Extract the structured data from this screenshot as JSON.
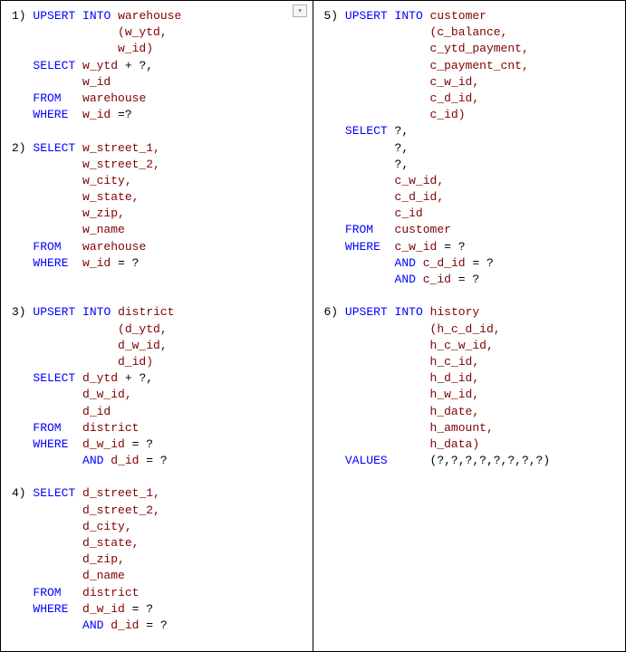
{
  "left": {
    "q1": {
      "num": "1)",
      "upsert": "UPSERT",
      "into": "INTO",
      "table": "warehouse",
      "col1": "(w_ytd,",
      "col2": "w_id)",
      "select": "SELECT",
      "sel1": "w_ytd",
      "plus": " + ?,",
      "sel2": "w_id",
      "from": "FROM",
      "from_t": "warehouse",
      "where": "WHERE",
      "cond": "w_id",
      "condop": " =?"
    },
    "q2": {
      "num": "2)",
      "select": "SELECT",
      "c1": "w_street_1,",
      "c2": "w_street_2,",
      "c3": "w_city,",
      "c4": "w_state,",
      "c5": "w_zip,",
      "c6": "w_name",
      "from": "FROM",
      "from_t": "warehouse",
      "where": "WHERE",
      "cond": "w_id",
      "condop": " = ?"
    },
    "q3": {
      "num": "3)",
      "upsert": "UPSERT",
      "into": "INTO",
      "table": "district",
      "col1": "(d_ytd,",
      "col2": "d_w_id,",
      "col3": "d_id)",
      "select": "SELECT",
      "sel1": "d_ytd",
      "plus": " + ?,",
      "sel2": "d_w_id,",
      "sel3": "d_id",
      "from": "FROM",
      "from_t": "district",
      "where": "WHERE",
      "cond1": "d_w_id",
      "op1": " = ?",
      "and": "AND",
      "cond2": "d_id",
      "op2": " = ?"
    },
    "q4": {
      "num": "4)",
      "select": "SELECT",
      "c1": "d_street_1,",
      "c2": "d_street_2,",
      "c3": "d_city,",
      "c4": "d_state,",
      "c5": "d_zip,",
      "c6": "d_name",
      "from": "FROM",
      "from_t": "district",
      "where": "WHERE",
      "cond1": "d_w_id",
      "op1": " = ?",
      "and": "AND",
      "cond2": "d_id",
      "op2": " = ?"
    }
  },
  "right": {
    "q5": {
      "num": "5)",
      "upsert": "UPSERT",
      "into": "INTO",
      "table": "customer",
      "col1": "(c_balance,",
      "col2": "c_ytd_payment,",
      "col3": "c_payment_cnt,",
      "col4": "c_w_id,",
      "col5": "c_d_id,",
      "col6": "c_id)",
      "select": "SELECT",
      "s1": "?,",
      "s2": "?,",
      "s3": "?,",
      "s4": "c_w_id,",
      "s5": "c_d_id,",
      "s6": "c_id",
      "from": "FROM",
      "from_t": "customer",
      "where": "WHERE",
      "cond1": "c_w_id",
      "op1": " = ?",
      "and1": "AND",
      "cond2": "c_d_id",
      "op2": " = ?",
      "and2": "AND",
      "cond3": "c_id",
      "op3": " = ?"
    },
    "q6": {
      "num": "6)",
      "upsert": "UPSERT",
      "into": "INTO",
      "table": "history",
      "col1": "(h_c_d_id,",
      "col2": "h_c_w_id,",
      "col3": "h_c_id,",
      "col4": "h_d_id,",
      "col5": "h_w_id,",
      "col6": "h_date,",
      "col7": "h_amount,",
      "col8": "h_data)",
      "values": "VALUES",
      "vlist": "(?,?,?,?,?,?,?,?)"
    }
  }
}
